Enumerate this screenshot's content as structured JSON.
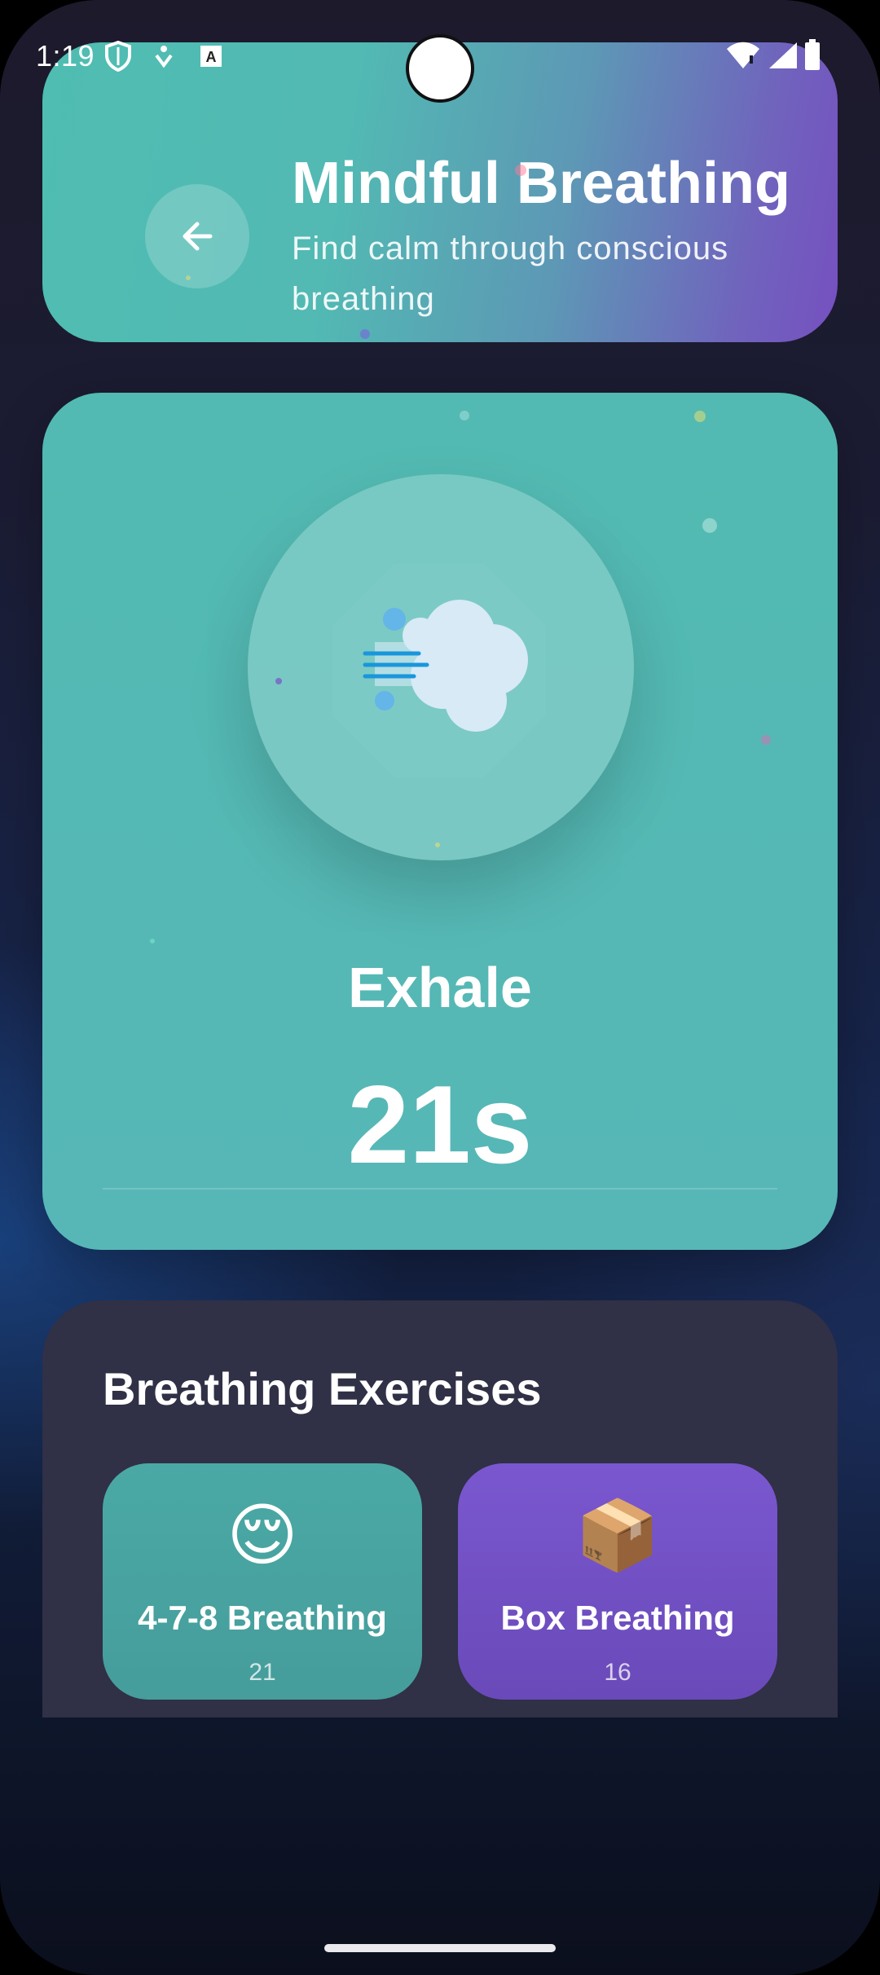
{
  "status_bar": {
    "time": "1:19",
    "icons": [
      "shield-icon",
      "accessibility-icon",
      "keyboard-icon",
      "wifi-icon",
      "signal-icon",
      "battery-icon"
    ]
  },
  "header": {
    "title": "Mindful Breathing",
    "subtitle": "Find calm through conscious breathing",
    "back_icon": "arrow-left-icon"
  },
  "breathing": {
    "phase": "Exhale",
    "timer": "21s",
    "icon": "wind-face-icon"
  },
  "exercises": {
    "title": "Breathing Exercises",
    "items": [
      {
        "emoji": "😌",
        "name": "4-7-8 Breathing",
        "sub": "21"
      },
      {
        "emoji": "📦",
        "name": "Box Breathing",
        "sub": "16"
      }
    ]
  },
  "colors": {
    "teal": "#52bab2",
    "purple": "#7650c0",
    "panel": "#303046"
  }
}
